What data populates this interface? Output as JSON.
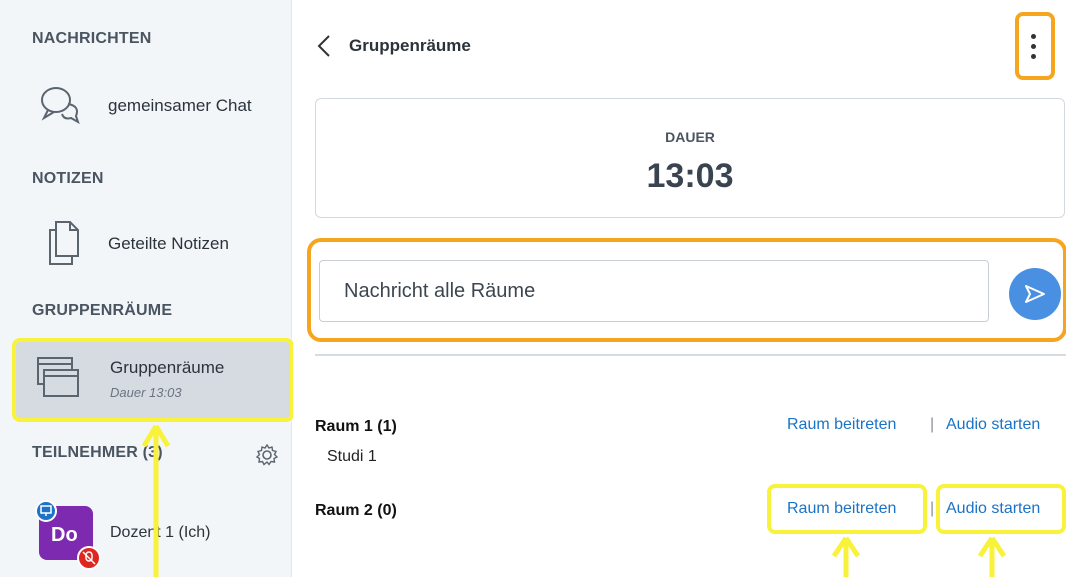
{
  "sidebar": {
    "messages_title": "NACHRICHTEN",
    "chat_label": "gemeinsamer Chat",
    "notes_title": "NOTIZEN",
    "notes_label": "Geteilte Notizen",
    "breakout_title": "GRUPPENRÄUME",
    "breakout_item": {
      "label": "Gruppenräume",
      "sub": "Dauer 13:03"
    },
    "participants_title": "TEILNEHMER (3)",
    "user": {
      "initials": "Do",
      "name": "Dozent 1 (Ich)"
    }
  },
  "header": {
    "title": "Gruppenräume"
  },
  "duration": {
    "label": "DAUER",
    "value": "13:03"
  },
  "message": {
    "placeholder": "Nachricht alle Räume"
  },
  "rooms": [
    {
      "title": "Raum 1 (1)",
      "members": [
        "Studi 1"
      ],
      "join": "Raum beitreten",
      "separator": "|",
      "audio": "Audio starten"
    },
    {
      "title": "Raum 2 (0)",
      "members": [],
      "join": "Raum beitreten",
      "separator": "|",
      "audio": "Audio starten"
    }
  ],
  "colors": {
    "highlight_orange": "#f6a51e",
    "highlight_yellow": "#f8f23a",
    "link_blue": "#1b73c6",
    "send_blue": "#4a90e2",
    "avatar_purple": "#7d2ab0"
  },
  "icons": [
    "chat-icon",
    "notes-icon",
    "breakout-room-icon",
    "gear-icon",
    "back-chevron-icon",
    "kebab-menu-icon",
    "send-icon",
    "presenter-icon",
    "muted-mic-icon"
  ]
}
